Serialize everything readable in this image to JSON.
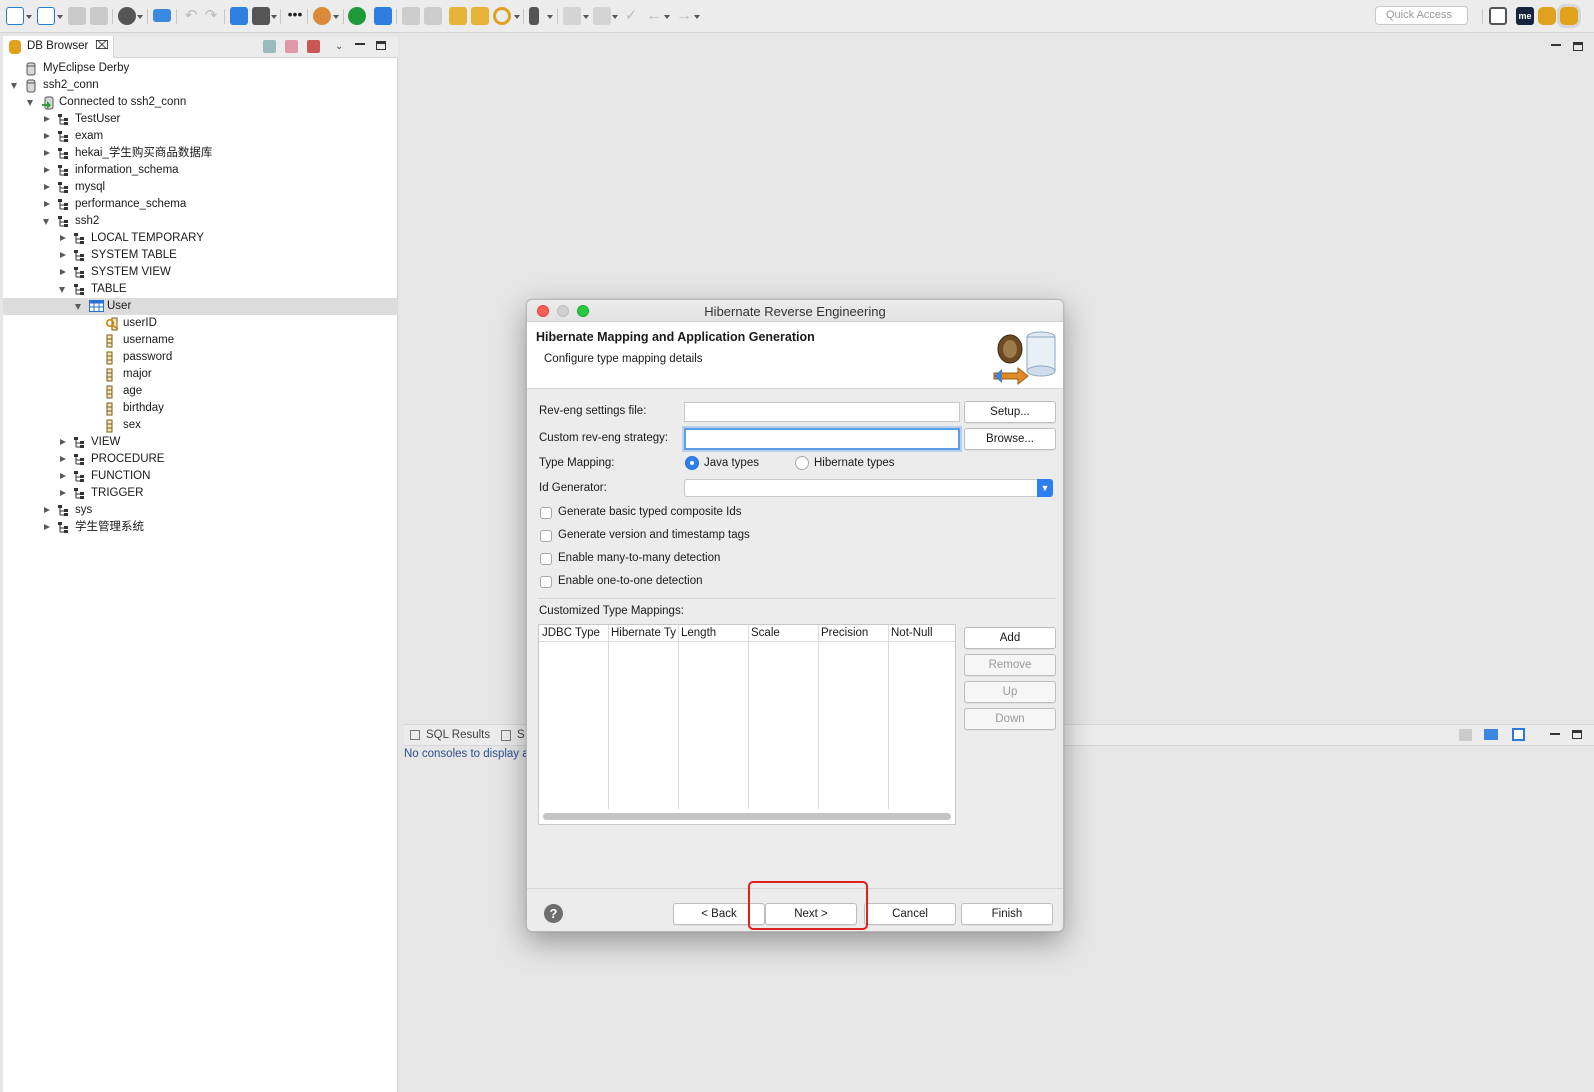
{
  "toolbar": {
    "quick_access_placeholder": "Quick Access",
    "buttons": [
      "new-wizard-icon",
      "new-object-icon",
      "save-icon",
      "save-all-icon",
      "user-icon",
      "monitor-icon",
      "undo-icon",
      "redo-icon",
      "publish-icon",
      "deploy-icon",
      "dots-icon",
      "palette-icon",
      "run-icon",
      "grid-icon",
      "folder-icon",
      "folder-open-icon",
      "image-icon",
      "folder-image-icon",
      "search-icon",
      "device-icon",
      "edit-icon",
      "edit2-icon",
      "nav-icon",
      "back-icon",
      "forward-icon"
    ],
    "perspectives": [
      "open-perspective-icon",
      "myeclipse-icon",
      "database-icon",
      "database-active-icon"
    ]
  },
  "db_browser": {
    "tab_title": "DB Browser",
    "tree": [
      {
        "label": "MyEclipse Derby",
        "level": 0,
        "kind": "db",
        "twisty": "none"
      },
      {
        "label": "ssh2_conn",
        "level": 0,
        "kind": "db",
        "twisty": "expanded"
      },
      {
        "label": "Connected to ssh2_conn",
        "level": 1,
        "kind": "conn",
        "twisty": "expanded"
      },
      {
        "label": "TestUser",
        "level": 2,
        "kind": "schema",
        "twisty": "collapsed"
      },
      {
        "label": "exam",
        "level": 2,
        "kind": "schema",
        "twisty": "collapsed"
      },
      {
        "label": "hekai_学生购买商品数据库",
        "level": 2,
        "kind": "schema",
        "twisty": "collapsed"
      },
      {
        "label": "information_schema",
        "level": 2,
        "kind": "schema",
        "twisty": "collapsed"
      },
      {
        "label": "mysql",
        "level": 2,
        "kind": "schema",
        "twisty": "collapsed"
      },
      {
        "label": "performance_schema",
        "level": 2,
        "kind": "schema",
        "twisty": "collapsed"
      },
      {
        "label": "ssh2",
        "level": 2,
        "kind": "schema",
        "twisty": "expanded"
      },
      {
        "label": "LOCAL TEMPORARY",
        "level": 3,
        "kind": "schema",
        "twisty": "collapsed"
      },
      {
        "label": "SYSTEM TABLE",
        "level": 3,
        "kind": "schema",
        "twisty": "collapsed"
      },
      {
        "label": "SYSTEM VIEW",
        "level": 3,
        "kind": "schema",
        "twisty": "collapsed"
      },
      {
        "label": "TABLE",
        "level": 3,
        "kind": "schema",
        "twisty": "expanded"
      },
      {
        "label": "User",
        "level": 4,
        "kind": "table",
        "twisty": "expanded",
        "selected": true
      },
      {
        "label": "userID",
        "level": 5,
        "kind": "key",
        "twisty": "none"
      },
      {
        "label": "username",
        "level": 5,
        "kind": "column",
        "twisty": "none"
      },
      {
        "label": "password",
        "level": 5,
        "kind": "column",
        "twisty": "none"
      },
      {
        "label": "major",
        "level": 5,
        "kind": "column",
        "twisty": "none"
      },
      {
        "label": "age",
        "level": 5,
        "kind": "column",
        "twisty": "none"
      },
      {
        "label": "birthday",
        "level": 5,
        "kind": "column",
        "twisty": "none"
      },
      {
        "label": "sex",
        "level": 5,
        "kind": "column",
        "twisty": "none"
      },
      {
        "label": "VIEW",
        "level": 3,
        "kind": "schema",
        "twisty": "collapsed"
      },
      {
        "label": "PROCEDURE",
        "level": 3,
        "kind": "schema",
        "twisty": "collapsed"
      },
      {
        "label": "FUNCTION",
        "level": 3,
        "kind": "schema",
        "twisty": "collapsed"
      },
      {
        "label": "TRIGGER",
        "level": 3,
        "kind": "schema",
        "twisty": "collapsed"
      },
      {
        "label": "sys",
        "level": 2,
        "kind": "schema",
        "twisty": "collapsed"
      },
      {
        "label": "学生管理系统",
        "level": 2,
        "kind": "schema",
        "twisty": "collapsed"
      }
    ]
  },
  "console": {
    "tab_sql_results": "SQL Results",
    "tab_second_partial": "S",
    "empty_message": "No consoles to display a"
  },
  "dialog": {
    "title": "Hibernate Reverse Engineering",
    "header_title": "Hibernate Mapping and Application Generation",
    "header_subtitle": "Configure type mapping details",
    "rev_eng_label": "Rev-eng settings file:",
    "rev_eng_value": "",
    "setup_button": "Setup...",
    "custom_strategy_label": "Custom rev-eng strategy:",
    "custom_strategy_value": "",
    "browse_button": "Browse...",
    "type_mapping_label": "Type Mapping:",
    "java_types_label": "Java types",
    "java_types_selected": true,
    "hibernate_types_label": "Hibernate types",
    "id_generator_label": "Id Generator:",
    "id_generator_value": "",
    "checkboxes": [
      {
        "label": "Generate basic typed composite Ids",
        "checked": false
      },
      {
        "label": "Generate version and timestamp tags",
        "checked": false
      },
      {
        "label": "Enable many-to-many detection",
        "checked": false
      },
      {
        "label": "Enable one-to-one detection",
        "checked": false
      }
    ],
    "customized_mappings_label": "Customized Type Mappings:",
    "table_columns": [
      "JDBC Type",
      "Hibernate Ty",
      "Length",
      "Scale",
      "Precision",
      "Not-Null"
    ],
    "add_button": "Add",
    "remove_button": "Remove",
    "up_button": "Up",
    "down_button": "Down",
    "back_button": "< Back",
    "next_button": "Next >",
    "cancel_button": "Cancel",
    "finish_button": "Finish",
    "help_icon": "?",
    "highlight_color": "#e0201c"
  }
}
